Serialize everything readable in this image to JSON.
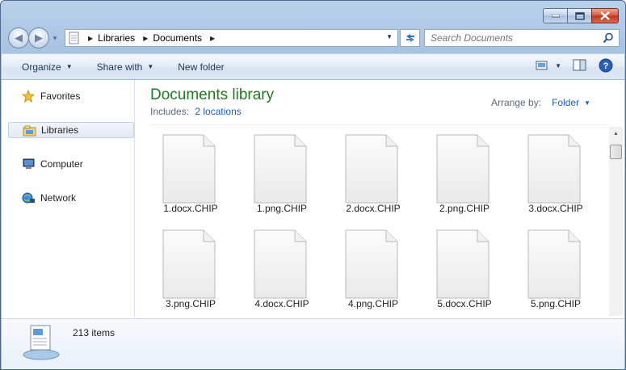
{
  "window": {
    "caption_buttons": [
      "minimize",
      "maximize",
      "close"
    ]
  },
  "address_bar": {
    "segments": [
      "Libraries",
      "Documents"
    ]
  },
  "search": {
    "placeholder": "Search Documents"
  },
  "toolbar": {
    "organize_label": "Organize",
    "share_label": "Share with",
    "new_folder_label": "New folder"
  },
  "nav": {
    "favorites": "Favorites",
    "libraries": "Libraries",
    "computer": "Computer",
    "network": "Network"
  },
  "library": {
    "title": "Documents library",
    "includes_label": "Includes:",
    "locations_link": "2 locations",
    "arrange_label": "Arrange by:",
    "arrange_value": "Folder"
  },
  "files": [
    "1.docx.CHIP",
    "1.png.CHIP",
    "2.docx.CHIP",
    "2.png.CHIP",
    "3.docx.CHIP",
    "3.png.CHIP",
    "4.docx.CHIP",
    "4.png.CHIP",
    "5.docx.CHIP",
    "5.png.CHIP"
  ],
  "status": {
    "item_count": "213 items"
  },
  "colors": {
    "title_green": "#1e7b1e",
    "link_blue": "#1a5fb4",
    "close_red": "#c1331a"
  }
}
